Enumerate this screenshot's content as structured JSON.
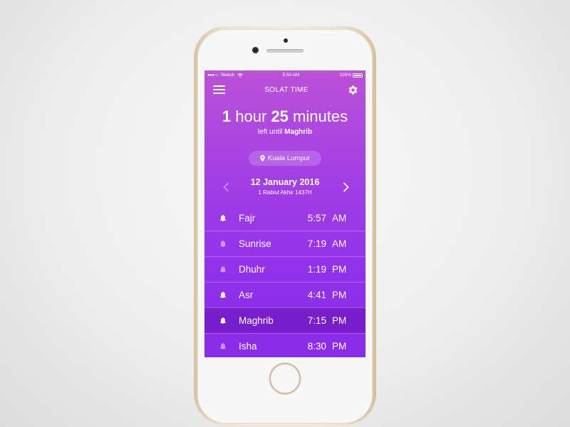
{
  "status_bar": {
    "carrier": "Sketch",
    "time": "5:50 AM",
    "battery": "100%"
  },
  "header": {
    "title": "SOLAT TIME",
    "menu_icon": "menu-icon",
    "settings_icon": "gear-icon"
  },
  "countdown": {
    "hours": "1",
    "hours_unit": "hour",
    "minutes": "25",
    "minutes_unit": "minutes",
    "subtitle_prefix": "left until",
    "next_prayer": "Maghrib"
  },
  "location": {
    "icon": "map-pin-icon",
    "name": "Kuala Lumpur"
  },
  "date": {
    "gregorian": "12 January 2016",
    "hijri": "1 Rabiul Akhir 1437H"
  },
  "prayers": [
    {
      "name": "Fajr",
      "time": "5:57",
      "period": "AM",
      "alarm_on": true,
      "active": false
    },
    {
      "name": "Sunrise",
      "time": "7:19",
      "period": "AM",
      "alarm_on": false,
      "active": false
    },
    {
      "name": "Dhuhr",
      "time": "1:19",
      "period": "PM",
      "alarm_on": false,
      "active": false
    },
    {
      "name": "Asr",
      "time": "4:41",
      "period": "PM",
      "alarm_on": true,
      "active": false
    },
    {
      "name": "Maghrib",
      "time": "7:15",
      "period": "PM",
      "alarm_on": true,
      "active": true
    },
    {
      "name": "Isha",
      "time": "8:30",
      "period": "PM",
      "alarm_on": false,
      "active": false
    }
  ],
  "colors": {
    "gradient_top": "#bc52d8",
    "gradient_bottom": "#8a2be9",
    "phone_gold": "#efe1c9"
  }
}
